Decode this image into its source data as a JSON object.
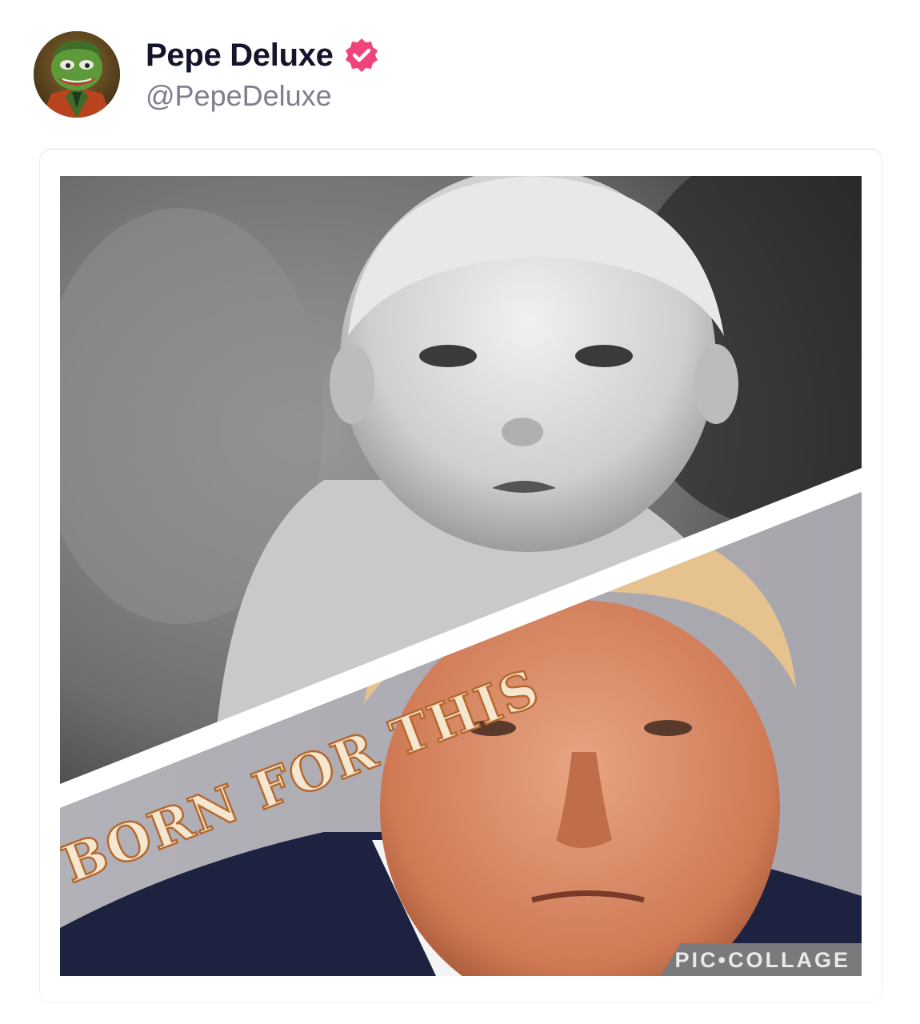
{
  "user": {
    "display_name": "Pepe Deluxe",
    "handle": "@PepeDeluxe",
    "verified": true,
    "verified_color": "#f0437a"
  },
  "post": {
    "image_caption": "BORN FOR THIS",
    "watermark": "PIC•COLLAGE"
  },
  "icons": {
    "verified": "verified-badge-icon",
    "avatar": "pepe-joker-avatar"
  }
}
